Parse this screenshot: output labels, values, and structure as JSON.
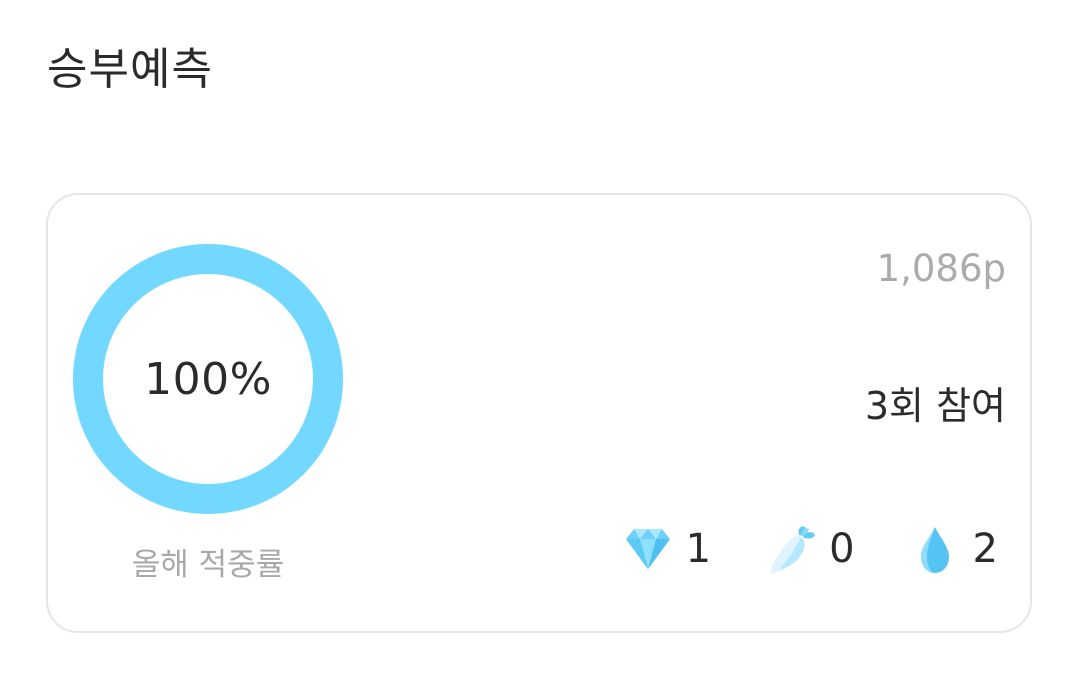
{
  "section": {
    "title": "승부예측"
  },
  "card": {
    "accuracy": {
      "value_text": "100%",
      "percent": 100,
      "label": "올해 적중률",
      "ring_color": "#72d8ff"
    },
    "points": "1,086p",
    "participation": "3회 참여",
    "stats": [
      {
        "icon": "diamond-icon",
        "value": "1"
      },
      {
        "icon": "radish-icon",
        "value": "0"
      },
      {
        "icon": "water-drop-icon",
        "value": "2"
      }
    ]
  },
  "colors": {
    "accent": "#72d8ff",
    "muted_text": "#a8a8a8",
    "border": "#e6e6e6"
  }
}
